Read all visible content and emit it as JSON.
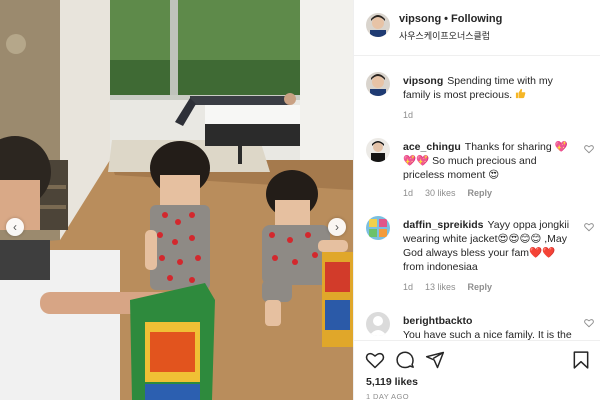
{
  "post": {
    "author": "vipsong",
    "follow_status": "Following",
    "location": "사우스케이프오너스클럽",
    "caption": {
      "username": "vipsong",
      "text": "Spending time with my family is most precious.",
      "emoji": "thumbs-up",
      "time": "1d"
    }
  },
  "comments": [
    {
      "username": "ace_chingu",
      "text": "Thanks for sharing 💖💖💖 So much precious and priceless moment 😍",
      "time": "1d",
      "likes": "30 likes",
      "reply": "Reply"
    },
    {
      "username": "daffin_spreikids",
      "text": "Yayy oppa jongkii wearing white jacket😍😍😊😊 ,May God always bless your fam❤️❤️ from indonesiaa",
      "time": "1d",
      "likes": "13 likes",
      "reply": "Reply"
    },
    {
      "username": "berightbackto",
      "text": "You have such a nice family. It is the greatest luck",
      "time": "",
      "likes": "",
      "reply": ""
    }
  ],
  "actions": {
    "like_icon": "heart-icon",
    "comment_icon": "comment-icon",
    "share_icon": "share-icon",
    "save_icon": "bookmark-icon"
  },
  "likes_count": "5,119 likes",
  "timestamp": "1 DAY AGO",
  "photo": {
    "prev_icon": "‹",
    "next_icon": "›"
  },
  "colors": {
    "text": "#262626",
    "muted": "#8e8e8e",
    "border": "#efefef",
    "floor": "#b98d5c"
  }
}
